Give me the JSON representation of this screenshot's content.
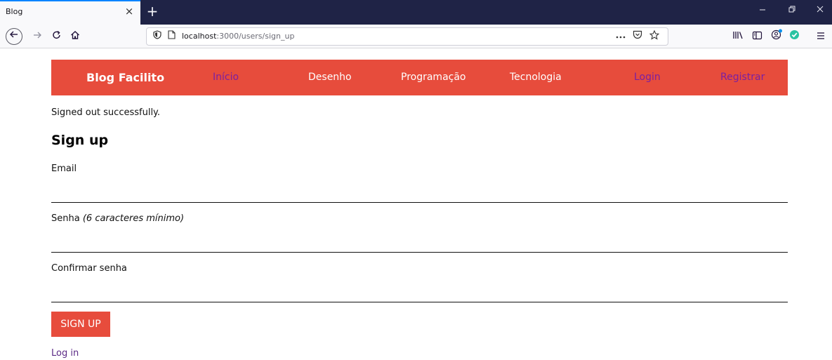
{
  "browser": {
    "tab_title": "Blog",
    "tab_close": "×",
    "new_tab": "+",
    "url_host": "localhost",
    "url_path": ":3000/users/sign_up",
    "icons": [
      "back-arrow-icon",
      "forward-arrow-icon",
      "reload-icon",
      "home-icon",
      "shield-icon",
      "page-icon",
      "more-icon",
      "pocket-icon",
      "star-icon",
      "library-icon",
      "sidebar-icon",
      "account-icon",
      "check-icon",
      "menu-icon"
    ]
  },
  "navbar": {
    "brand": "Blog Facilito",
    "items": [
      {
        "label": "Início"
      },
      {
        "label": "Desenho"
      },
      {
        "label": "Programação"
      },
      {
        "label": "Tecnologia"
      },
      {
        "label": "Login"
      },
      {
        "label": "Registrar"
      }
    ]
  },
  "flash": "Signed out successfully.",
  "form": {
    "heading": "Sign up",
    "email_label": "Email",
    "password_label": "Senha",
    "password_hint": "(6 caracteres mínimo)",
    "confirm_label": "Confirmar senha",
    "submit_label": "Sign up",
    "email_value": "",
    "password_value": "",
    "confirm_value": ""
  },
  "login_link": "Log in",
  "colors": {
    "navbar": "#e74c3c",
    "visited_link": "#7b1fa2",
    "tabbar": "#1f2346"
  }
}
